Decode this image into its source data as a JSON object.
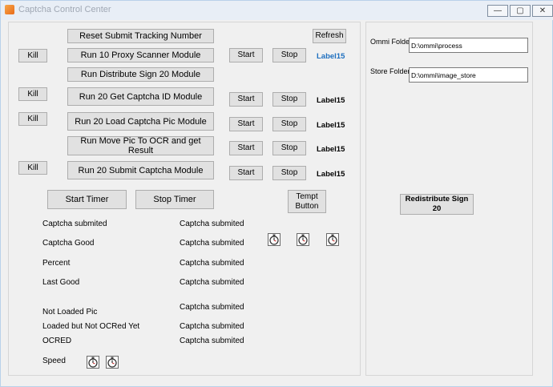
{
  "window": {
    "title": "Captcha Control Center",
    "minimize": "—",
    "maximize": "▢",
    "close": "✕"
  },
  "buttons": {
    "reset": "Reset Submit Tracking Number",
    "refresh": "Refresh",
    "proxy": "Run 10 Proxy Scanner Module",
    "distribute": "Run Distribute Sign 20 Module",
    "get_id": "Run 20 Get Captcha ID Module",
    "load_pic": "Run 20 Load Captcha Pic Module",
    "move_pic": "Run Move Pic To OCR and get Result",
    "submit": "Run 20 Submit Captcha Module",
    "kill": "Kill",
    "start": "Start",
    "stop": "Stop",
    "start_timer": "Start Timer",
    "stop_timer": "Stop Timer",
    "tempt": "Tempt Button",
    "redistribute": "Redistribute Sign 20"
  },
  "status_label": "Label15",
  "stats_labels": {
    "captcha_submitted": "Captcha submited",
    "captcha_good": "Captcha Good",
    "percent": "Percent",
    "last_good": "Last Good",
    "not_loaded": "Not Loaded Pic",
    "loaded_not_ocred": "Loaded but Not OCRed Yet",
    "ocred": "OCRED",
    "speed": "Speed"
  },
  "stats_value": "Captcha submited",
  "fields": {
    "ommi_label": "Ommi Folder",
    "ommi_value": "D:\\ommi\\process",
    "store_label": "Store Folder",
    "store_value": "D:\\ommi\\image_store"
  },
  "icons": {
    "timer": "stopwatch-icon"
  }
}
